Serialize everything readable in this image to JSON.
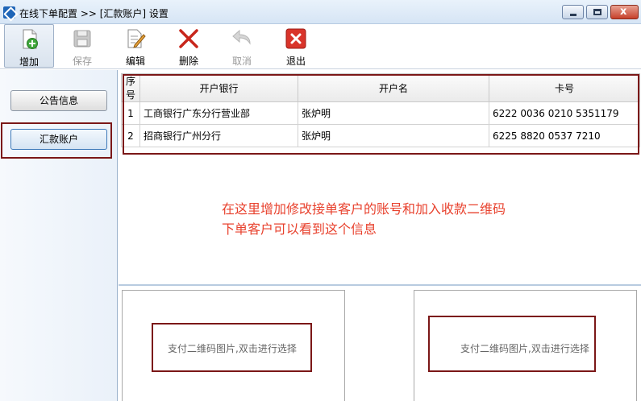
{
  "window": {
    "title": "在线下单配置 >> [汇款账户] 设置",
    "min_symbol": "",
    "close_symbol": "x"
  },
  "toolbar": {
    "buttons": [
      {
        "label": "增加",
        "icon": "add-document-icon",
        "state": "active"
      },
      {
        "label": "保存",
        "icon": "floppy-disk-icon",
        "state": "disabled"
      },
      {
        "label": "编辑",
        "icon": "edit-document-icon",
        "state": "enabled"
      },
      {
        "label": "删除",
        "icon": "red-x-icon",
        "state": "enabled"
      },
      {
        "label": "取消",
        "icon": "undo-arrow-icon",
        "state": "disabled"
      },
      {
        "label": "退出",
        "icon": "exit-icon",
        "state": "enabled"
      }
    ]
  },
  "sidebar": {
    "items": [
      {
        "label": "公告信息"
      },
      {
        "label": "汇款账户",
        "selected": true
      }
    ]
  },
  "table": {
    "columns": [
      "序号",
      "开户银行",
      "开户名",
      "卡号"
    ],
    "rows": [
      [
        "1",
        "工商银行广东分行营业部",
        "张炉明",
        "6222 0036 0210 5351179"
      ],
      [
        "2",
        "招商银行广州分行",
        "张炉明",
        "6225 8820 0537 7210"
      ]
    ]
  },
  "annotation": {
    "line1": "在这里增加修改接单客户的账号和加入收款二维码",
    "line2": "下单客户可以看到这个信息"
  },
  "qr_panels": [
    {
      "placeholder": "支付二维码图片,双击进行选择"
    },
    {
      "placeholder": "支付二维码图片,双击进行选择"
    }
  ],
  "colors": {
    "annotation_red": "#e8412d",
    "highlight_box": "#7b1717",
    "titlebar": "#d6e5f5"
  }
}
